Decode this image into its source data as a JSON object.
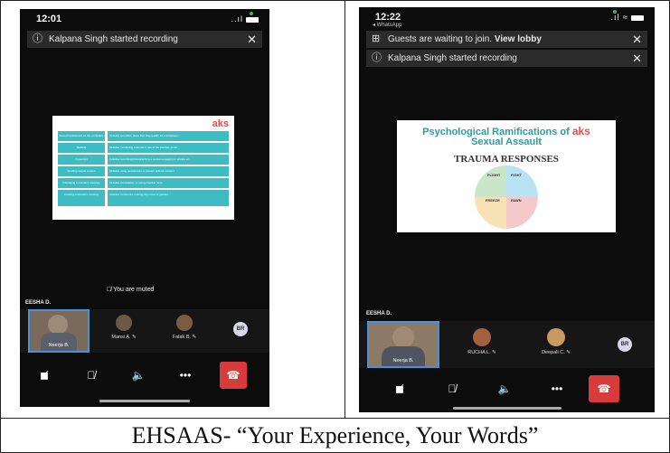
{
  "caption": "EHSAAS- “Your Experience, Your Words”",
  "left_phone": {
    "time": "12:01",
    "signal": "..ıl",
    "banner": {
      "icon": "info-icon",
      "text": "Kalpana Singh started recording",
      "close": "✕"
    },
    "slide": {
      "logo": "aks",
      "rows": [
        {
          "left": "Sexual harassment on the workplace",
          "right": "Includes sex either place that may qualify as a workplace..."
        },
        {
          "left": "Stalking",
          "right": "Includes monitoring a woman's use of the internet, email"
        },
        {
          "left": "Voyeurism",
          "right": "Includes recording/photographing a woman engaging in private act"
        },
        {
          "left": "Sending sexual content",
          "right": "Includes using sexual texts or content without consent"
        },
        {
          "left": "Damaging a woman's modesty",
          "right": "Includes intimidation, or using physical force"
        },
        {
          "left": "Insulting a woman's modesty",
          "right": "Includes comments, making any noise or gesture"
        }
      ]
    },
    "speaker_name": "EESHA D.",
    "muted_text": "You are muted",
    "participants": [
      {
        "name": "Neerja B."
      },
      {
        "name": "Mansi A. ✎"
      },
      {
        "name": "Falak B. ✎"
      },
      {
        "initials": "BR"
      }
    ],
    "controls": [
      "camera-off-icon",
      "mic-off-icon",
      "speaker-icon",
      "more-icon",
      "hang-up-icon"
    ],
    "more_label": "•••",
    "hang_label": "☎"
  },
  "right_phone": {
    "time": "12:22",
    "back_app": "◂ WhatsApp",
    "signal": ".ıl ≈",
    "banner1": {
      "icon": "lobby-icon",
      "text": "Guests are waiting to join.",
      "link": "View lobby",
      "close": "✕"
    },
    "banner2": {
      "icon": "info-icon",
      "text": "Kalpana Singh started recording",
      "close": "✕"
    },
    "slide": {
      "title1": "Psychological Ramifications of",
      "logo": "aks",
      "title2": "Sexual Assault",
      "title3": "TRAUMA RESPONSES",
      "quadrants": {
        "q1": "FLIGHT",
        "q2": "FIGHT",
        "q3": "FREEZE",
        "q4": "FAWN"
      }
    },
    "speaker_name": "EESHA D.",
    "participants": [
      {
        "name": "Neerja B."
      },
      {
        "name": "RUCHA L. ✎"
      },
      {
        "name": "Deepali C. ✎"
      },
      {
        "initials": "BR"
      }
    ],
    "more_label": "•••",
    "hang_label": "☎"
  }
}
